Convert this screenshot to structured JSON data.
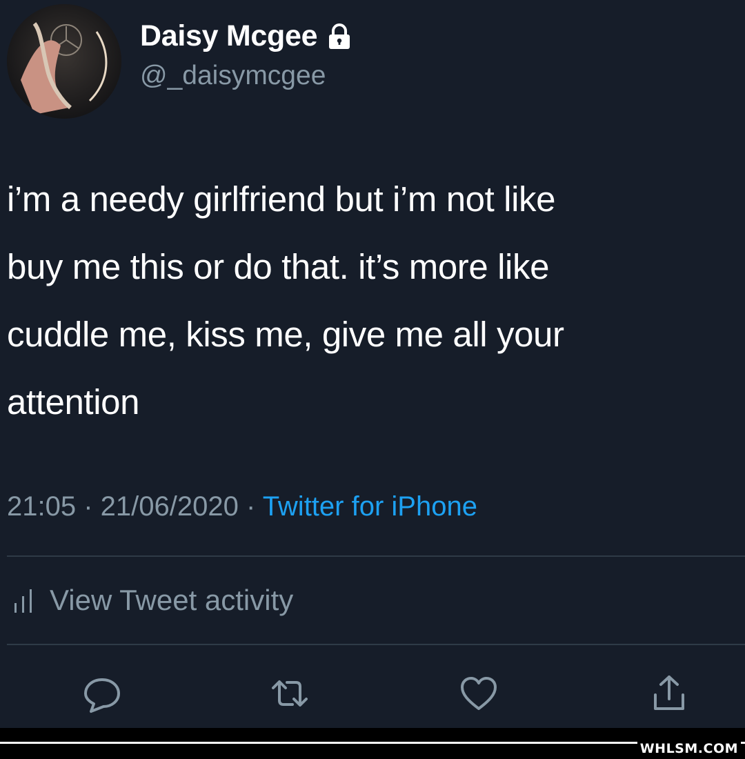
{
  "tweet": {
    "author": {
      "display_name": "Daisy Mcgee",
      "handle": "@_daisymcgee",
      "avatar_icon": "avatar-photo",
      "protected_icon": "lock-icon"
    },
    "text_lines": [
      "i’m a needy girlfriend but i’m not like",
      "buy me this or do that. it’s more like",
      "cuddle me, kiss me, give me all your",
      "attention"
    ],
    "meta": {
      "time": "21:05",
      "separator": " · ",
      "date": "21/06/2020",
      "source": "Twitter for iPhone"
    },
    "activity_label": "View Tweet activity",
    "actions": {
      "reply_icon": "reply-icon",
      "retweet_icon": "retweet-icon",
      "like_icon": "heart-icon",
      "share_icon": "share-icon"
    }
  },
  "watermark": "WHLSM.COM",
  "colors": {
    "background": "#161d29",
    "text_primary": "#ffffff",
    "text_secondary": "#8899a6",
    "link": "#1da1f2",
    "divider": "#2f3b47"
  }
}
